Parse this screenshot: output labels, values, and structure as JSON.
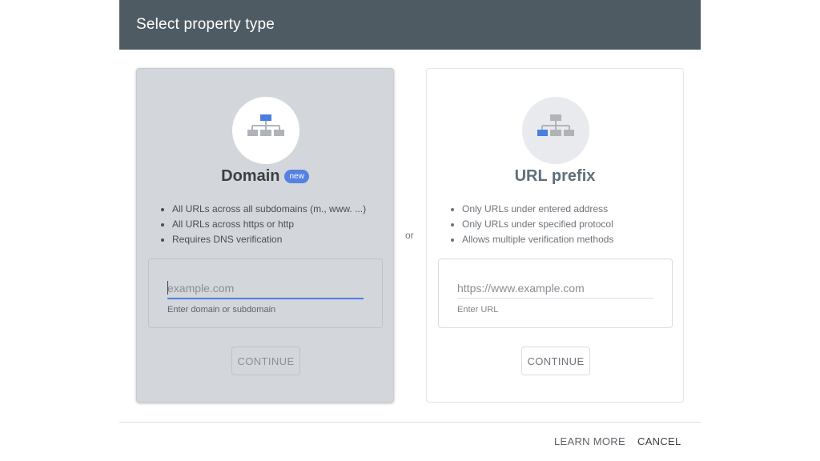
{
  "dialog": {
    "title": "Select property type",
    "separator": "or"
  },
  "domain_card": {
    "title": "Domain",
    "badge": "new",
    "icon": "sitemap-icon",
    "bullets": [
      "All URLs across all subdomains (m., www. ...)",
      "All URLs across https or http",
      "Requires DNS verification"
    ],
    "input": {
      "value": "",
      "placeholder": "example.com"
    },
    "hint": "Enter domain or subdomain",
    "continue_label": "CONTINUE"
  },
  "url_card": {
    "title": "URL prefix",
    "icon": "sitemap-icon",
    "bullets": [
      "Only URLs under entered address",
      "Only URLs under specified protocol",
      "Allows multiple verification methods"
    ],
    "input": {
      "value": "",
      "placeholder": "https://www.example.com"
    },
    "hint": "Enter URL",
    "continue_label": "CONTINUE"
  },
  "footer": {
    "learn_more": "LEARN MORE",
    "cancel": "CANCEL"
  },
  "colors": {
    "header_bg": "#4f5b62",
    "accent_blue": "#4a7fe0",
    "badge_blue": "#5581e0",
    "selected_card_bg": "#d3d7dc"
  }
}
